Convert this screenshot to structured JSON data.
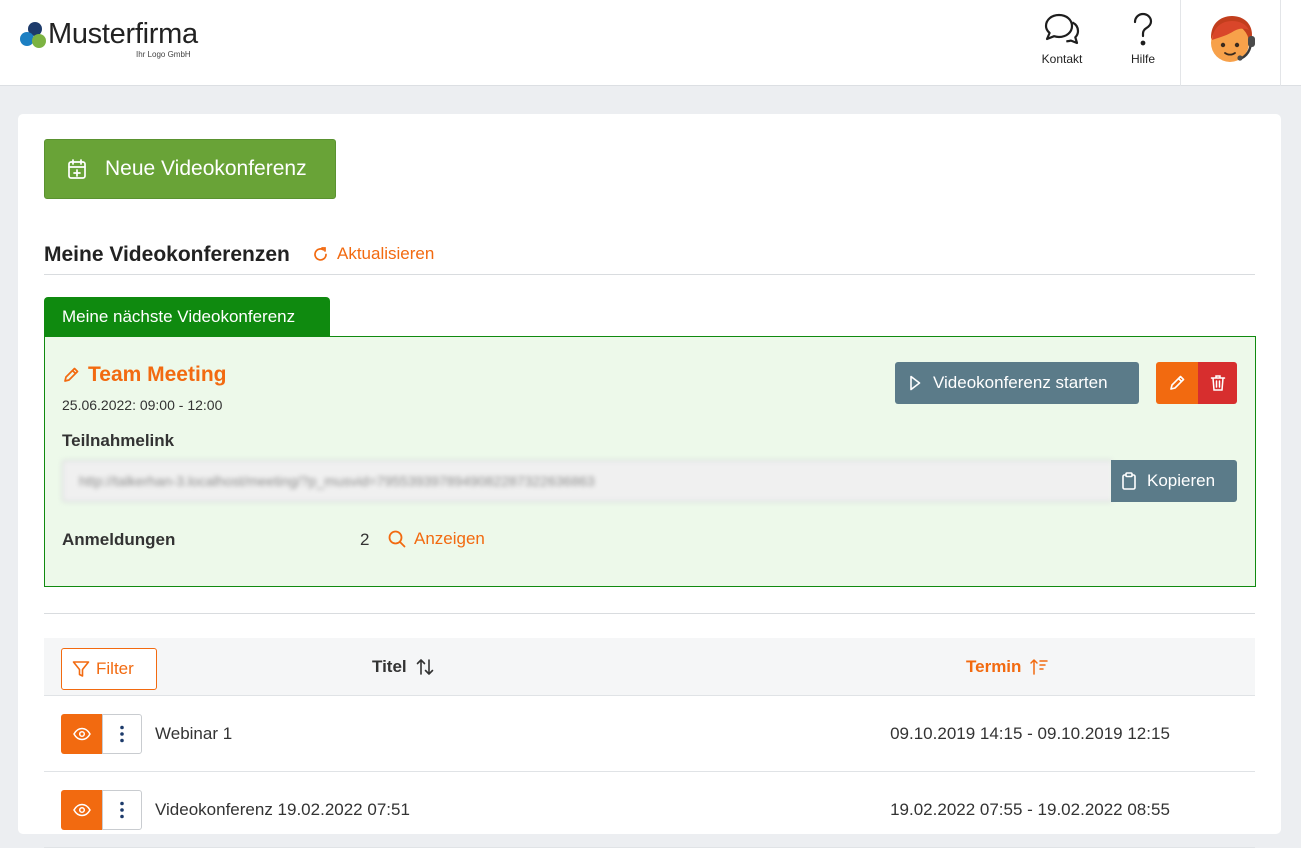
{
  "header": {
    "logo": {
      "name": "Musterfirma",
      "subtitle": "Ihr Logo GmbH",
      "dot_colors": [
        "#1c7fc2",
        "#7cb342",
        "#1d3b6b"
      ]
    },
    "contact_label": "Kontakt",
    "help_label": "Hilfe"
  },
  "actions": {
    "new_conference_label": "Neue Videokonferenz"
  },
  "my_conferences": {
    "title": "Meine Videokonferenzen",
    "refresh_label": "Aktualisieren"
  },
  "next_conference": {
    "tab_label": "Meine nächste Videokonferenz",
    "title": "Team Meeting",
    "date": "25.06.2022: 09:00 - 12:00",
    "start_label": "Videokonferenz starten",
    "link_label": "Teilnahmelink",
    "link_value": "http://talkerhan-3.localhost/meeting/?p_musvid=7955393978949082287322636863",
    "copy_label": "Kopieren",
    "registrations_label": "Anmeldungen",
    "registrations_count": "2",
    "show_label": "Anzeigen"
  },
  "table": {
    "filter_label": "Filter",
    "columns": {
      "title": "Titel",
      "date": "Termin"
    },
    "rows": [
      {
        "title": "Webinar 1",
        "date": "09.10.2019 14:15 - 09.10.2019 12:15"
      },
      {
        "title": "Videokonferenz 19.02.2022 07:51",
        "date": "19.02.2022 07:55 - 19.02.2022 08:55"
      }
    ]
  },
  "colors": {
    "accent": "#f26a10",
    "primary_green": "#69a337",
    "next_green": "#0f8a0f",
    "slate": "#5b7b89",
    "danger": "#d72e2e"
  }
}
